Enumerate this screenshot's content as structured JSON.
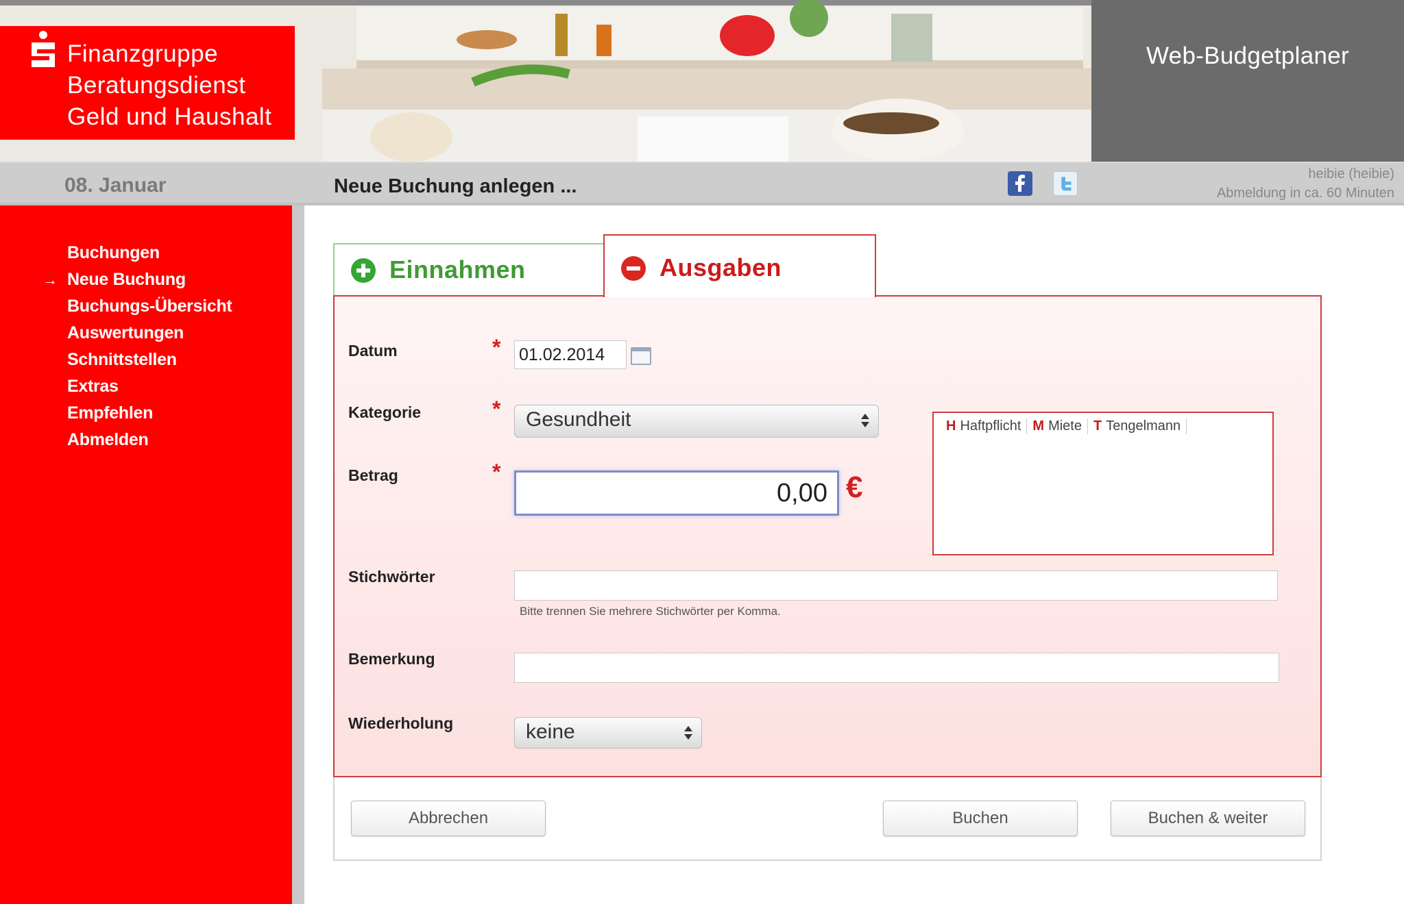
{
  "header": {
    "brand_lines": [
      "Finanzgruppe",
      "Beratungsdienst",
      "Geld und Haushalt"
    ],
    "app_title": "Web-Budgetplaner"
  },
  "bar": {
    "date": "08. Januar",
    "page_title": "Neue Buchung anlegen ...",
    "user": "heibie (heibie)",
    "logout_info": "Abmeldung in ca. 60 Minuten"
  },
  "sidebar": {
    "items": [
      {
        "label": "Buchungen",
        "active": false
      },
      {
        "label": "Neue Buchung",
        "active": true
      },
      {
        "label": "Buchungs-Übersicht",
        "active": false
      },
      {
        "label": "Auswertungen",
        "active": false
      },
      {
        "label": "Schnittstellen",
        "active": false
      },
      {
        "label": "Extras",
        "active": false
      },
      {
        "label": "Empfehlen",
        "active": false
      },
      {
        "label": "Abmelden",
        "active": false
      }
    ],
    "active_marker": "→"
  },
  "tabs": {
    "income": "Einnahmen",
    "expenses": "Ausgaben"
  },
  "form": {
    "required_marker": "*",
    "datum": {
      "label": "Datum",
      "value": "01.02.2014"
    },
    "kategorie": {
      "label": "Kategorie",
      "value": "Gesundheit"
    },
    "betrag": {
      "label": "Betrag",
      "value": "0,00",
      "currency": "€"
    },
    "favorites": [
      {
        "key": "H",
        "label": "Haftpflicht"
      },
      {
        "key": "M",
        "label": "Miete"
      },
      {
        "key": "T",
        "label": "Tengelmann"
      }
    ],
    "stichwoerter": {
      "label": "Stichwörter",
      "value": "",
      "hint": "Bitte trennen Sie mehrere Stichwörter per Komma."
    },
    "bemerkung": {
      "label": "Bemerkung",
      "value": ""
    },
    "wiederholung": {
      "label": "Wiederholung",
      "value": "keine"
    }
  },
  "buttons": {
    "cancel": "Abbrechen",
    "book": "Buchen",
    "book_next": "Buchen & weiter"
  },
  "colors": {
    "brand_red": "#ff0000",
    "income_green": "#3f9b33",
    "expense_red": "#cc1b1b",
    "header_grey": "#6b6b6b"
  }
}
